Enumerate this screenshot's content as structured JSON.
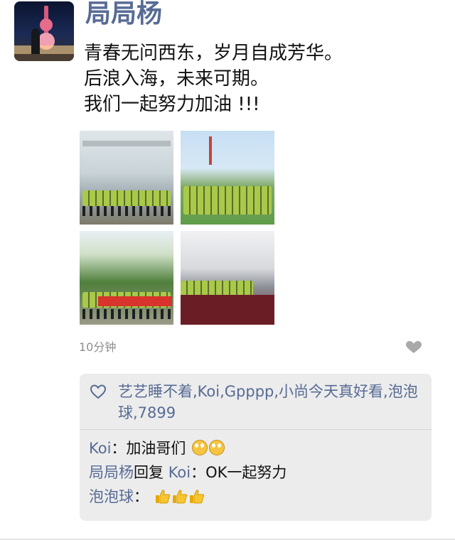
{
  "post": {
    "username": "局局杨",
    "text_lines": [
      "青春无问西东，岁月自成芳华。",
      "后浪入海，未来可期。",
      "我们一起努力加油 !!!"
    ],
    "time": "10分钟"
  },
  "photos": [
    {
      "name": "photo-1"
    },
    {
      "name": "photo-2"
    },
    {
      "name": "photo-3"
    },
    {
      "name": "photo-4"
    }
  ],
  "likes": {
    "icon": "heart-icon",
    "names": "艺艺睡不着,Koi,Gpppp,小尚今天真好看,泡泡球,7899"
  },
  "comments": [
    {
      "author": "Koi",
      "separator": "：",
      "text": "加油哥们",
      "emoji": "face-emoji"
    },
    {
      "author": "局局杨",
      "reply_word": "回复",
      "reply_to": "Koi",
      "separator": "：",
      "text": "OK一起努力"
    },
    {
      "author": "泡泡球",
      "separator": "：",
      "text": "",
      "emoji": "thumbs-up-emoji"
    }
  ],
  "colors": {
    "name_blue": "#576b95",
    "comment_bg": "#ececec",
    "time_gray": "#8d8d8d"
  }
}
